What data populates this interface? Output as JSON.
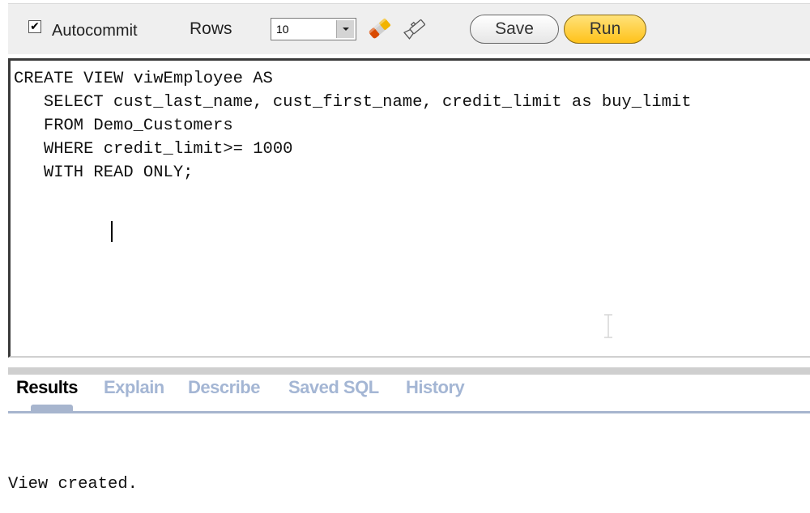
{
  "toolbar": {
    "autocommit": {
      "label": "Autocommit",
      "checked": true,
      "check_glyph": "✔"
    },
    "rows": {
      "label": "Rows",
      "value": "10"
    },
    "icons": [
      "eraser-icon",
      "flashlight-icon"
    ],
    "save_label": "Save",
    "run_label": "Run"
  },
  "editor": {
    "sql": "CREATE VIEW viwEmployee AS\n   SELECT cust_last_name, cust_first_name, credit_limit as buy_limit\n   FROM Demo_Customers\n   WHERE credit_limit>= 1000\n   WITH READ ONLY;"
  },
  "tabs": [
    {
      "label": "Results",
      "active": true
    },
    {
      "label": "Explain",
      "active": false
    },
    {
      "label": "Describe",
      "active": false
    },
    {
      "label": "Saved SQL",
      "active": false
    },
    {
      "label": "History",
      "active": false
    }
  ],
  "colors": {
    "run_button": "#ffc21a",
    "tab_inactive": "#a4b6d4",
    "tab_rule": "#a7b5ce"
  },
  "results": {
    "message": "View created."
  }
}
